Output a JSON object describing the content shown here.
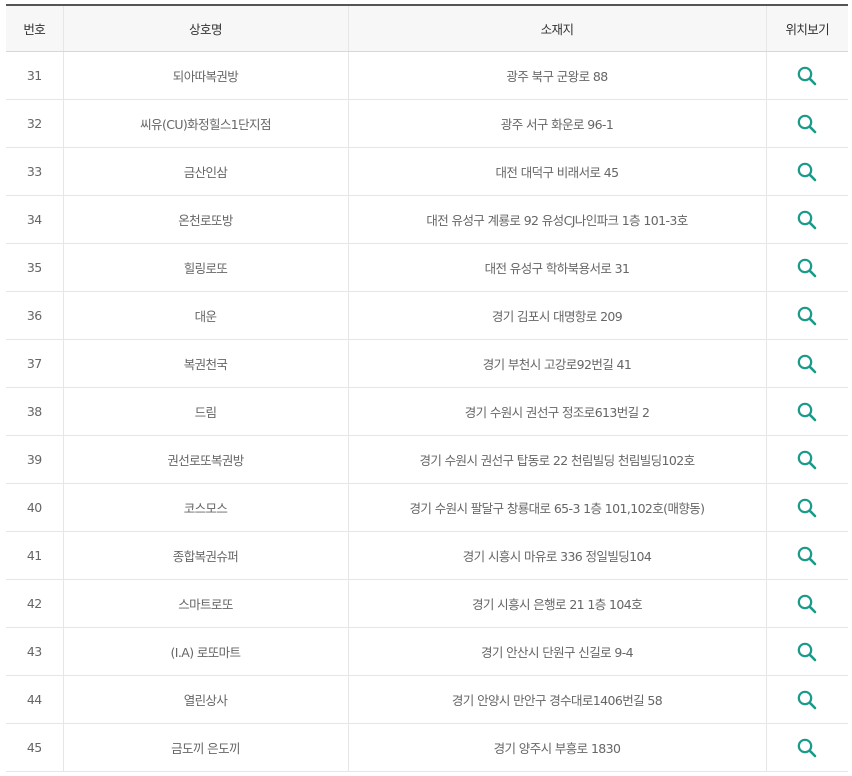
{
  "table": {
    "headers": {
      "no": "번호",
      "name": "상호명",
      "address": "소재지",
      "location": "위치보기"
    },
    "accent_color": "#1a9a8a",
    "location_icon": "search-icon",
    "rows": [
      {
        "no": "31",
        "name": "되아따복권방",
        "address": "광주 북구 군왕로 88"
      },
      {
        "no": "32",
        "name": "씨유(CU)화정힐스1단지점",
        "address": "광주 서구 화운로 96-1"
      },
      {
        "no": "33",
        "name": "금산인삼",
        "address": "대전 대덕구 비래서로 45"
      },
      {
        "no": "34",
        "name": "온천로또방",
        "address": "대전 유성구 계룡로 92 유성CJ나인파크 1층 101-3호"
      },
      {
        "no": "35",
        "name": "힐링로또",
        "address": "대전 유성구 학하북용서로 31"
      },
      {
        "no": "36",
        "name": "대운",
        "address": "경기 김포시 대명항로 209"
      },
      {
        "no": "37",
        "name": "복권천국",
        "address": "경기 부천시 고강로92번길 41"
      },
      {
        "no": "38",
        "name": "드림",
        "address": "경기 수원시 권선구 정조로613번길 2"
      },
      {
        "no": "39",
        "name": "권선로또복권방",
        "address": "경기 수원시 권선구 탑동로 22 천림빌딩 천림빌딩102호"
      },
      {
        "no": "40",
        "name": "코스모스",
        "address": "경기 수원시 팔달구 창룡대로 65-3 1층 101,102호(매향동)"
      },
      {
        "no": "41",
        "name": "종합복권슈퍼",
        "address": "경기 시흥시 마유로 336 정일빌딩104"
      },
      {
        "no": "42",
        "name": "스마트로또",
        "address": "경기 시흥시 은행로 21 1층 104호"
      },
      {
        "no": "43",
        "name": "(I.A) 로또마트",
        "address": "경기 안산시 단원구 신길로 9-4"
      },
      {
        "no": "44",
        "name": "열린상사",
        "address": "경기 안양시 만안구 경수대로1406번길 58"
      },
      {
        "no": "45",
        "name": "금도끼 은도끼",
        "address": "경기 양주시 부흥로 1830"
      }
    ]
  }
}
